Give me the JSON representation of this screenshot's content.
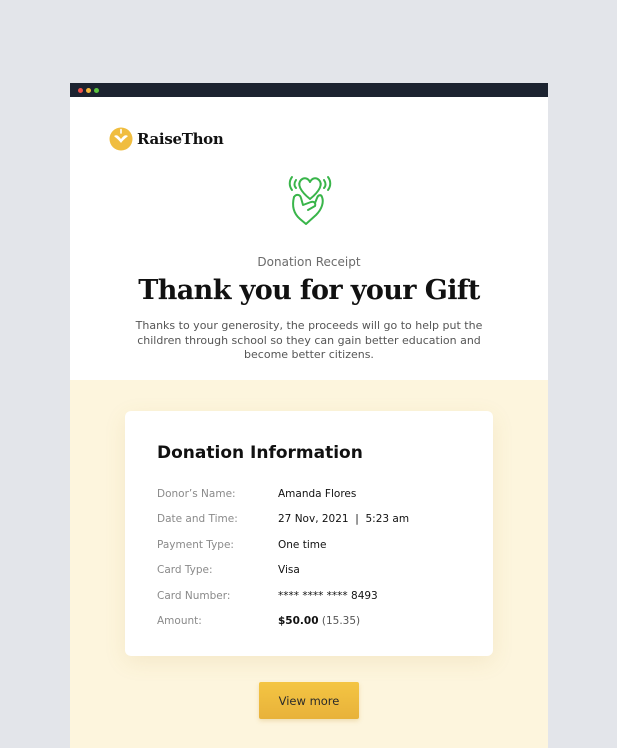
{
  "brand": {
    "name": "RaiseThon"
  },
  "hero": {
    "eyebrow": "Donation Receipt",
    "headline": "Thank you for your Gift",
    "lead": "Thanks to your generosity, the proceeds will go to help put the children through school so they can gain better education and become better citizens."
  },
  "donation": {
    "title": "Donation Information",
    "rows": [
      {
        "label": "Donor’s Name:",
        "value": "Amanda Flores"
      },
      {
        "label": "Date and Time:",
        "value": "27 Nov, 2021  |  5:23 am"
      },
      {
        "label": "Payment Type:",
        "value": "One time"
      },
      {
        "label": "Card Type:",
        "value": "Visa"
      },
      {
        "label": "Card Number:",
        "value": "**** **** **** 8493"
      },
      {
        "label": "Amount:",
        "value_main": "$50.00",
        "value_sub": "(15.35)"
      }
    ]
  },
  "actions": {
    "view_more": "View more"
  },
  "colors": {
    "accent": "#f0bd3f",
    "icon_green": "#39b54a",
    "cream": "#fdf5dd",
    "titlebar": "#1c2330"
  },
  "icons": {
    "logo": "heart-hands-logo-icon",
    "hero": "hand-holding-heart-icon"
  }
}
